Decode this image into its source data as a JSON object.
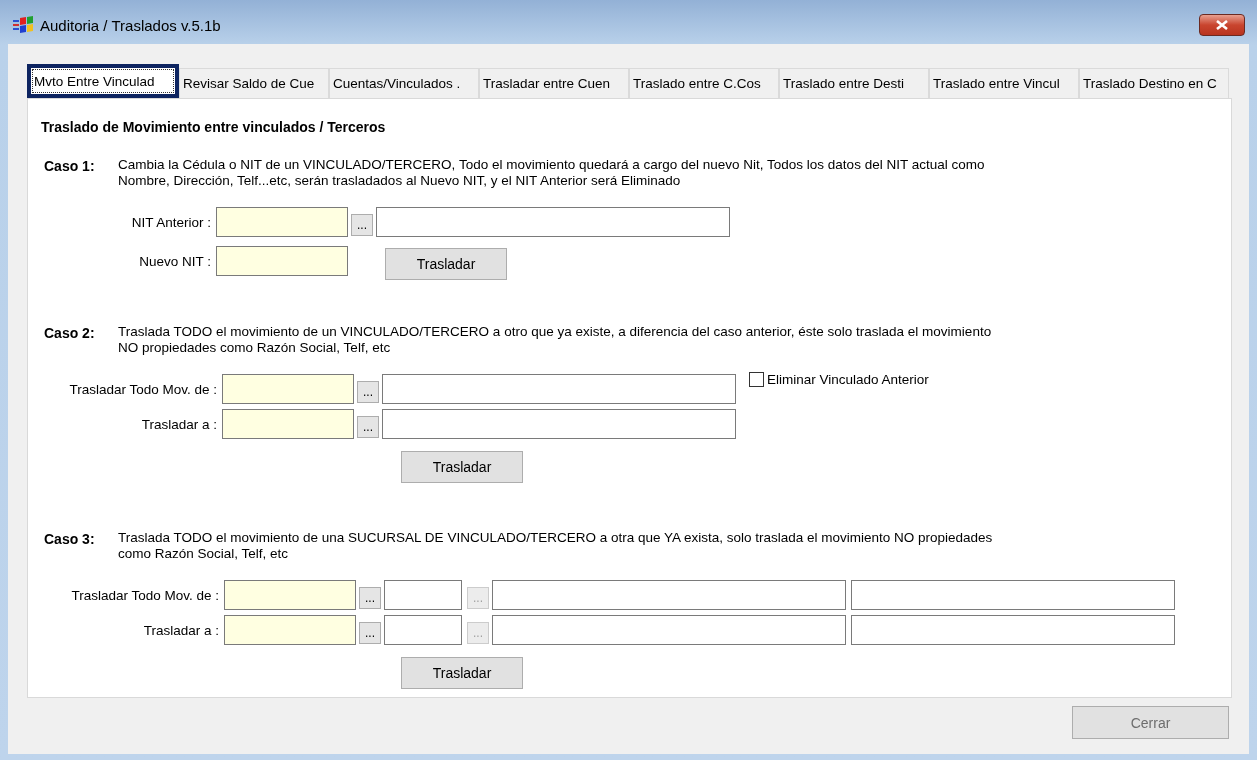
{
  "window": {
    "title": "Auditoria / Traslados  v.5.1b"
  },
  "tabs": [
    {
      "label": "Mvto Entre Vinculad",
      "selected": true
    },
    {
      "label": "Revisar Saldo de Cue",
      "selected": false
    },
    {
      "label": "Cuentas/Vinculados .",
      "selected": false
    },
    {
      "label": "Trasladar entre Cuen",
      "selected": false
    },
    {
      "label": "Traslado entre C.Cos",
      "selected": false
    },
    {
      "label": "Traslado entre Desti",
      "selected": false
    },
    {
      "label": "Traslado entre Vincul",
      "selected": false
    },
    {
      "label": "Traslado Destino en C",
      "selected": false
    }
  ],
  "heading": "Traslado de Movimiento entre vinculados / Terceros",
  "cases": [
    {
      "label": "Caso 1:",
      "description": "Cambia la Cédula o NIT de un VINCULADO/TERCERO, Todo el movimiento quedará a cargo del nuevo Nit, Todos los datos del NIT actual como Nombre, Dirección, Telf...etc, serán trasladados al Nuevo NIT, y el NIT Anterior será Eliminado",
      "rows": [
        {
          "label": "NIT Anterior :",
          "fields": [
            {
              "kind": "code"
            },
            {
              "kind": "browse",
              "label": "...",
              "disabled": false
            },
            {
              "kind": "name"
            }
          ]
        },
        {
          "label": "Nuevo NIT :",
          "fields": [
            {
              "kind": "code"
            }
          ],
          "button": {
            "label": "Trasladar"
          }
        }
      ]
    },
    {
      "label": "Caso 2:",
      "description": "Traslada TODO el movimiento de un VINCULADO/TERCERO a otro que ya existe, a diferencia del caso anterior, éste solo traslada el movimiento NO propiedades como Razón Social, Telf, etc",
      "rows": [
        {
          "label": "Trasladar Todo Mov. de :",
          "fields": [
            {
              "kind": "code"
            },
            {
              "kind": "browse",
              "label": "...",
              "disabled": false
            },
            {
              "kind": "name"
            }
          ],
          "checkbox": {
            "label": "Eliminar Vinculado Anterior",
            "checked": false
          }
        },
        {
          "label": "Trasladar a :",
          "fields": [
            {
              "kind": "code"
            },
            {
              "kind": "browse",
              "label": "...",
              "disabled": false
            },
            {
              "kind": "name"
            }
          ]
        }
      ],
      "button": {
        "label": "Trasladar"
      }
    },
    {
      "label": "Caso 3:",
      "description": "Traslada TODO el movimiento de una SUCURSAL DE VINCULADO/TERCERO a otra que YA exista, solo traslada el movimiento NO propiedades como Razón Social, Telf, etc",
      "rows": [
        {
          "label": "Trasladar Todo Mov. de :",
          "fields": [
            {
              "kind": "code"
            },
            {
              "kind": "browse",
              "label": "...",
              "disabled": false
            },
            {
              "kind": "short"
            },
            {
              "kind": "browse",
              "label": "...",
              "disabled": true
            },
            {
              "kind": "name"
            },
            {
              "kind": "detail"
            }
          ]
        },
        {
          "label": "Trasladar a :",
          "fields": [
            {
              "kind": "code"
            },
            {
              "kind": "browse",
              "label": "...",
              "disabled": false
            },
            {
              "kind": "short"
            },
            {
              "kind": "browse",
              "label": "...",
              "disabled": true
            },
            {
              "kind": "name"
            },
            {
              "kind": "detail"
            }
          ]
        }
      ],
      "button": {
        "label": "Trasladar"
      }
    }
  ],
  "close_button": {
    "label": "Cerrar"
  }
}
